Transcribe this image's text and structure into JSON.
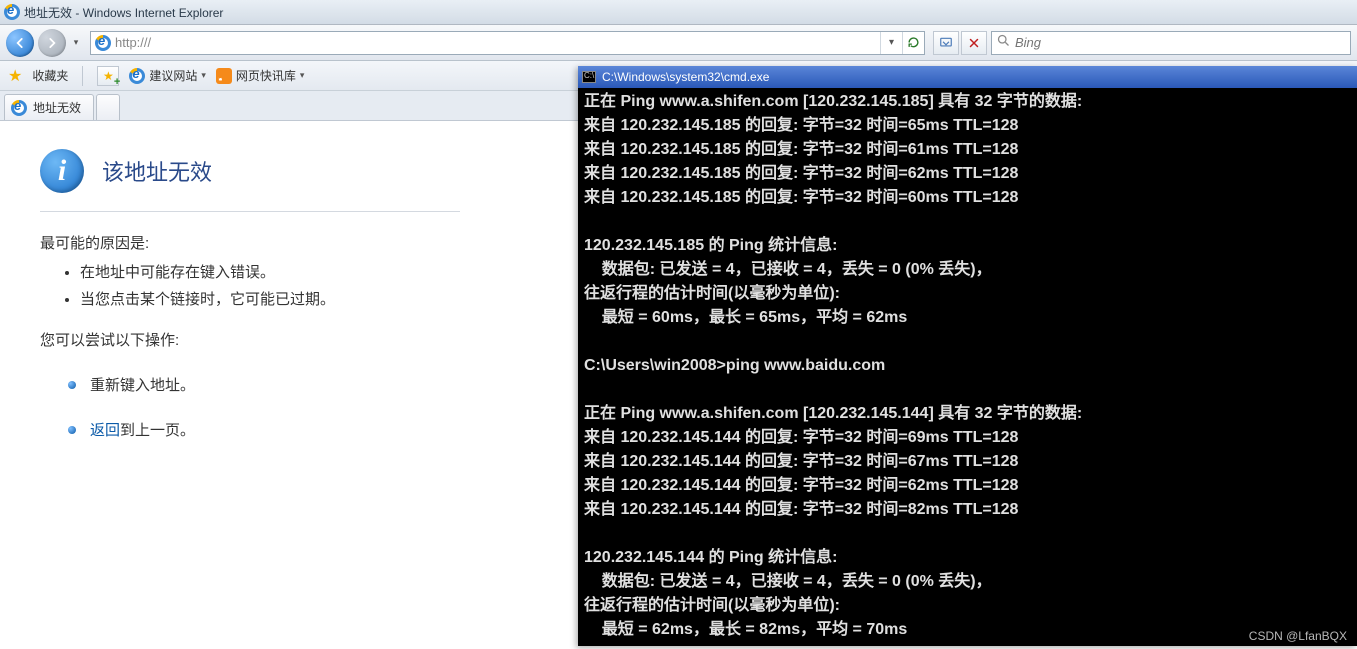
{
  "ie": {
    "title_page": "地址无效",
    "title_sep": " - ",
    "title_app": "Windows Internet Explorer",
    "address_value": "http:///",
    "search_placeholder": "Bing",
    "favorites_label": "收藏夹",
    "suggested_sites": "建议网站",
    "web_slice": "网页快讯库",
    "tab_label": "地址无效"
  },
  "error": {
    "heading": "该地址无效",
    "cause_label": "最可能的原因是:",
    "causes": [
      "在地址中可能存在键入错误。",
      "当您点击某个链接时，它可能已过期。"
    ],
    "try_label": "您可以尝试以下操作:",
    "action1": "重新键入地址。",
    "action2_link": "返回",
    "action2_rest": "到上一页。"
  },
  "cmd": {
    "title": "C:\\Windows\\system32\\cmd.exe",
    "lines": [
      "正在 Ping www.a.shifen.com [120.232.145.185] 具有 32 字节的数据:",
      "来自 120.232.145.185 的回复: 字节=32 时间=65ms TTL=128",
      "来自 120.232.145.185 的回复: 字节=32 时间=61ms TTL=128",
      "来自 120.232.145.185 的回复: 字节=32 时间=62ms TTL=128",
      "来自 120.232.145.185 的回复: 字节=32 时间=60ms TTL=128",
      "",
      "120.232.145.185 的 Ping 统计信息:",
      "    数据包: 已发送 = 4，已接收 = 4，丢失 = 0 (0% 丢失)，",
      "往返行程的估计时间(以毫秒为单位):",
      "    最短 = 60ms，最长 = 65ms，平均 = 62ms",
      "",
      "C:\\Users\\win2008>ping www.baidu.com",
      "",
      "正在 Ping www.a.shifen.com [120.232.145.144] 具有 32 字节的数据:",
      "来自 120.232.145.144 的回复: 字节=32 时间=69ms TTL=128",
      "来自 120.232.145.144 的回复: 字节=32 时间=67ms TTL=128",
      "来自 120.232.145.144 的回复: 字节=32 时间=62ms TTL=128",
      "来自 120.232.145.144 的回复: 字节=32 时间=82ms TTL=128",
      "",
      "120.232.145.144 的 Ping 统计信息:",
      "    数据包: 已发送 = 4，已接收 = 4，丢失 = 0 (0% 丢失)，",
      "往返行程的估计时间(以毫秒为单位):",
      "    最短 = 62ms，最长 = 82ms，平均 = 70ms"
    ]
  },
  "watermark": "CSDN @LfanBQX"
}
